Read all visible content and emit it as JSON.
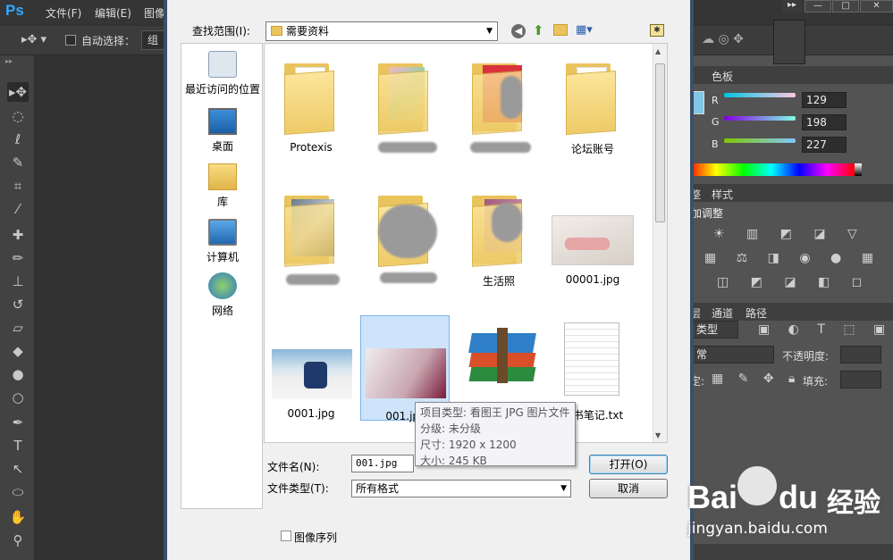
{
  "ps": {
    "logo": "Ps",
    "menus": [
      "文件(F)",
      "编辑(E)",
      "图像"
    ],
    "options": {
      "auto_select_label": "自动选择：",
      "group_value": "组"
    }
  },
  "window_controls": [
    "▸▸",
    "—",
    "□",
    "✕"
  ],
  "color_panel": {
    "tabs": [
      "色板"
    ],
    "channels": [
      {
        "label": "R",
        "value": "129",
        "color": "#e06060"
      },
      {
        "label": "G",
        "value": "198",
        "color": "#9e5fd9"
      },
      {
        "label": "B",
        "value": "227",
        "color": "#7bbf4a"
      }
    ]
  },
  "adjust_panel": {
    "tabs": [
      "整",
      "样式"
    ],
    "title": "加调整"
  },
  "layers_panel": {
    "tabs": [
      "层",
      "通道",
      "路径"
    ],
    "kind_label": "类型",
    "blend_label": "常",
    "opacity_label": "不透明度:",
    "lock_label": "定:",
    "fill_label": "填充:"
  },
  "dialog": {
    "look_in_label": "查找范围(I):",
    "look_in_value": "需要资料",
    "places": [
      "最近访问的位置",
      "桌面",
      "库",
      "计算机",
      "网络"
    ],
    "items": [
      {
        "name": "Protexis",
        "type": "folder"
      },
      {
        "name": "",
        "type": "folder-blur"
      },
      {
        "name": "",
        "type": "folder-blur"
      },
      {
        "name": "论坛账号",
        "type": "folder"
      },
      {
        "name": "",
        "type": "folder-blur"
      },
      {
        "name": "",
        "type": "folder-blur"
      },
      {
        "name": "生活照",
        "type": "folder"
      },
      {
        "name": "00001.jpg",
        "type": "image"
      },
      {
        "name": "0001.jpg",
        "type": "image"
      },
      {
        "name": "001.jpg",
        "type": "image-selected"
      },
      {
        "name": "",
        "type": "archive"
      },
      {
        "name": "读书笔记.txt",
        "type": "text"
      }
    ],
    "tooltip": {
      "type": "项目类型: 看图王 JPG 图片文件",
      "rating": "分级: 未分级",
      "size": "尺寸: 1920 x 1200",
      "filesize": "大小: 245 KB"
    },
    "filename_label": "文件名(N):",
    "filename_value": "001.jpg",
    "filetype_label": "文件类型(T):",
    "filetype_value": "所有格式",
    "open_button": "打开(O)",
    "cancel_button": "取消",
    "sequence_label": "图像序列"
  },
  "watermark": {
    "brand": "Bai",
    "brand2": "du",
    "cn": "经验",
    "url": "jingyan.baidu.com"
  }
}
